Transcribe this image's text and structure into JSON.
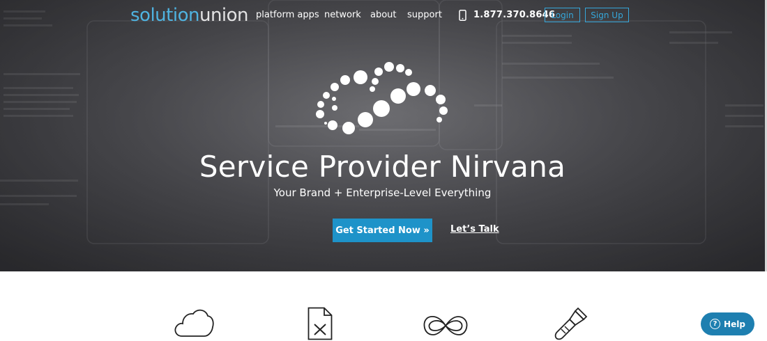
{
  "header": {
    "logo_part1": "solution",
    "logo_part2": "union",
    "nav": [
      {
        "label": "platform apps"
      },
      {
        "label": "network"
      },
      {
        "label": "about"
      },
      {
        "label": "support"
      }
    ],
    "phone": "1.877.370.8646",
    "login_label": "Login",
    "signup_label": "Sign Up"
  },
  "hero": {
    "title": "Service Provider Nirvana",
    "subtitle": "Your Brand + Enterprise-Level Everything",
    "cta_label": "Get Started Now »",
    "secondary_label": "Let’s Talk"
  },
  "features": {
    "icons": [
      "cloud-icon",
      "document-x-icon",
      "infinity-icon",
      "paintbrush-icon"
    ]
  },
  "help_widget": {
    "label": "Help",
    "icon_glyph": "?"
  },
  "colors": {
    "accent": "#35a7db",
    "cta": "#1e93c9",
    "help": "#1e7fb0"
  }
}
